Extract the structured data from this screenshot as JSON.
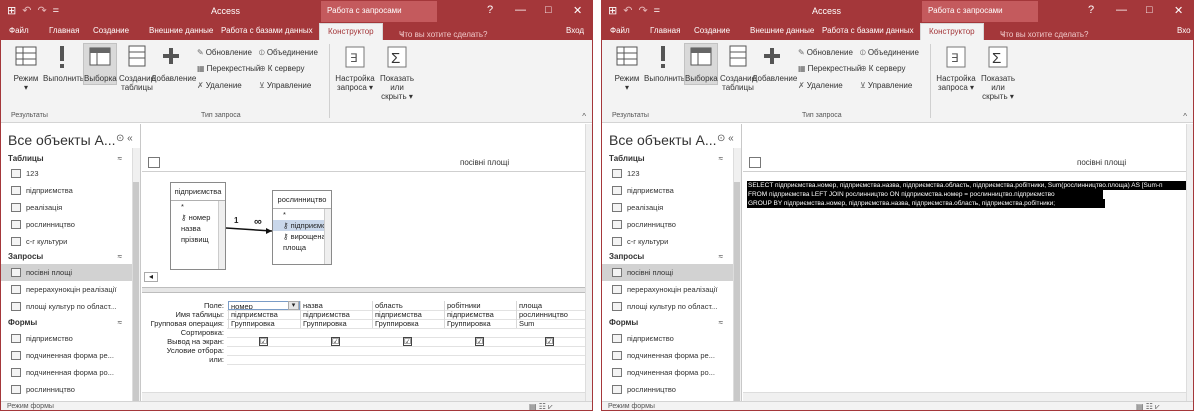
{
  "app": {
    "quick_access": [
      "⊞",
      "↶",
      "↷",
      "="
    ],
    "title": "Access",
    "context_tab": "Работа с запросами",
    "help_btn": "?",
    "min_btn": "—",
    "max_btn": "□",
    "close_btn": "✕"
  },
  "tabs": {
    "file": "Файл",
    "home": "Главная",
    "create": "Создание",
    "external": "Внешние данные",
    "db": "Работа с базами данных",
    "design": "Конструктор",
    "tell": "Что вы хотите сделать?",
    "signin": "Вход",
    "signin_short": "Вхо"
  },
  "ribbon": {
    "view": "Режим",
    "run": "Выполнить",
    "select": "Выборка",
    "make_table_1": "Создание",
    "make_table_2": "таблицы",
    "append": "Добавление",
    "update": "Обновление",
    "crosstab": "Перекрестный",
    "delete": "Удаление",
    "union": "Объединение",
    "passthrough": "К серверу",
    "ddl": "Управление",
    "setup_1": "Настройка",
    "setup_2": "запроса ▾",
    "showhide_1": "Показать или",
    "showhide_2": "скрыть ▾",
    "group_results": "Результаты",
    "group_qtype": "Тип запроса",
    "collapse": "^"
  },
  "nav": {
    "title": "Все объекты А...",
    "title_btn": "⊙ «",
    "sections": [
      {
        "label": "Таблицы",
        "chev": "≈"
      },
      {
        "label": "Запросы",
        "chev": "≈"
      },
      {
        "label": "Формы",
        "chev": "≈"
      }
    ],
    "tables": [
      "123",
      "підприємства",
      "реалізація",
      "рослинництво",
      "с-г культури"
    ],
    "queries": [
      "посівні площі",
      "перерахунокцін реалізації",
      "площі культур по област..."
    ],
    "forms": [
      "підприємство",
      "подчиненная форма ре...",
      "подчиненная форма ро...",
      "рослинництво"
    ]
  },
  "query": {
    "name": "посівні площі",
    "table1": {
      "title": "підприємства",
      "fields": [
        "*",
        "номер",
        "назва",
        "прізвищ"
      ]
    },
    "table2": {
      "title": "рослинництво",
      "fields": [
        "*",
        "підприємство",
        "вирощена культура",
        "площа"
      ]
    },
    "rel_one": "1",
    "rel_many": "∞",
    "grid_labels": [
      "Поле:",
      "Имя таблицы:",
      "Групповая операция:",
      "Сортировка:",
      "Вывод на экран:",
      "Условие отбора:",
      "или:"
    ],
    "columns": [
      {
        "field": "номер",
        "table": "підприємства",
        "group": "Группировка",
        "show": "☑"
      },
      {
        "field": "назва",
        "table": "підприємства",
        "group": "Группировка",
        "show": "☑"
      },
      {
        "field": "область",
        "table": "підприємства",
        "group": "Группировка",
        "show": "☑"
      },
      {
        "field": "робітники",
        "table": "підприємства",
        "group": "Группировка",
        "show": "☑"
      },
      {
        "field": "площа",
        "table": "рослинництво",
        "group": "Sum",
        "show": "☑"
      }
    ],
    "sql": [
      "SELECT підприємства.номер, підприємства.назва, підприємства.область, підприємства.робітники, Sum(рослинництво.площа) AS [Sum-п",
      "FROM підприємства LEFT JOIN рослинництво ON підприємства.номер = рослинництво.підприємство",
      "GROUP BY підприємства.номер, підприємства.назва, підприємства.область, підприємства.робітники;"
    ]
  },
  "status": {
    "left": "Режим формы",
    "views": "▤   ☷   ⩗"
  },
  "colors": {
    "accent": "#a4373a",
    "ribbon": "#f3f3f3",
    "selected_nav": "#d2d2d2"
  }
}
